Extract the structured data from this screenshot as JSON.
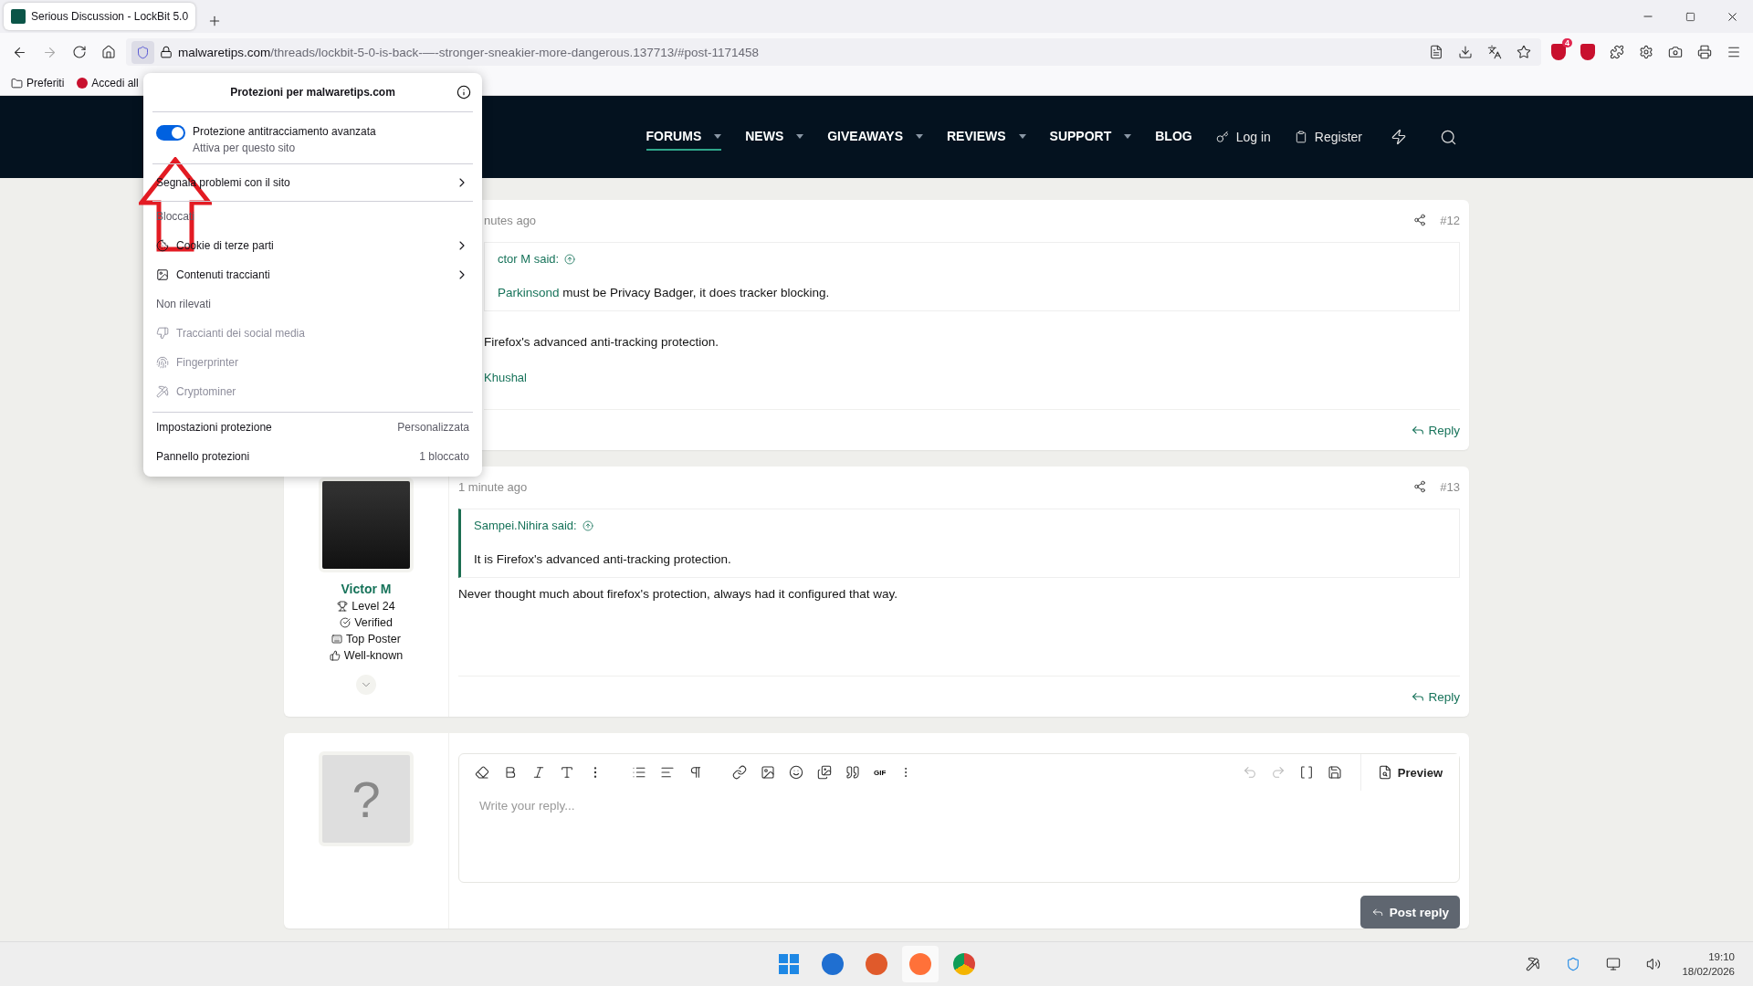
{
  "browser": {
    "tabs": [
      {
        "title": "Serious Discussion - LockBit 5.0",
        "selected": true
      }
    ],
    "url": {
      "domain": "malwaretips.com",
      "path": "/threads/lockbit-5-0-is-back-—-stronger-sneakier-more-dangerous.137713/#post-1171458"
    },
    "extension_badge": "4",
    "bookmarks": [
      "Preferiti",
      "Accedi all"
    ]
  },
  "protections_popup": {
    "title": "Protezioni per malwaretips.com",
    "toggle": {
      "label": "Protezione antitracciamento avanzata",
      "sublabel": "Attiva per questo sito",
      "on": true
    },
    "report": "Segnala problemi con il sito",
    "blocked": {
      "heading": "Bloccati",
      "items": [
        {
          "kind": "cookie",
          "label": "Cookie di terze parti"
        },
        {
          "kind": "content",
          "label": "Contenuti traccianti"
        }
      ]
    },
    "not_detected": {
      "heading": "Non rilevati",
      "items": [
        {
          "kind": "social",
          "label": "Traccianti dei social media"
        },
        {
          "kind": "fingerprint",
          "label": "Fingerprinter"
        },
        {
          "kind": "crypto",
          "label": "Cryptominer"
        }
      ]
    },
    "footer": [
      {
        "label": "Impostazioni protezione",
        "value": "Personalizzata"
      },
      {
        "label": "Pannello protezioni",
        "value": "1 bloccato"
      }
    ]
  },
  "site_nav": {
    "items": [
      {
        "label": "FORUMS",
        "dropdown": true,
        "selected": true
      },
      {
        "label": "NEWS",
        "dropdown": true,
        "selected": false
      },
      {
        "label": "GIVEAWAYS",
        "dropdown": true,
        "selected": false
      },
      {
        "label": "REVIEWS",
        "dropdown": true,
        "selected": false
      },
      {
        "label": "SUPPORT",
        "dropdown": true,
        "selected": false
      },
      {
        "label": "BLOG",
        "dropdown": false,
        "selected": false
      }
    ],
    "login": "Log in",
    "register": "Register"
  },
  "posts": [
    {
      "time": "nutes ago",
      "number": "#12",
      "quote": {
        "author": "ctor M said:",
        "mention": "Parkinsond",
        "text": " must be Privacy Badger, it does tracker blocking."
      },
      "body": "Firefox's advanced anti-tracking protection.",
      "signature": "Khushal",
      "reply": "Reply"
    },
    {
      "time": "1 minute ago",
      "number": "#13",
      "user": {
        "name": "Victor M",
        "badges": [
          {
            "kind": "level",
            "label": "Level 24"
          },
          {
            "kind": "verified",
            "label": "Verified"
          },
          {
            "kind": "poster",
            "label": "Top Poster"
          },
          {
            "kind": "known",
            "label": "Well-known"
          }
        ]
      },
      "quote": {
        "author": "Sampei.Nihira said:",
        "text": "It is Firefox's advanced anti-tracking protection."
      },
      "body": "Never thought much about firefox's protection, always had it configured that way.",
      "reply": "Reply"
    }
  ],
  "editor": {
    "avatar": "?",
    "gif_label": "GIF",
    "preview": "Preview",
    "placeholder": "Write your reply...",
    "submit": "Post reply"
  },
  "taskbar": {
    "time": "19:10",
    "date": "18/02/2026"
  }
}
